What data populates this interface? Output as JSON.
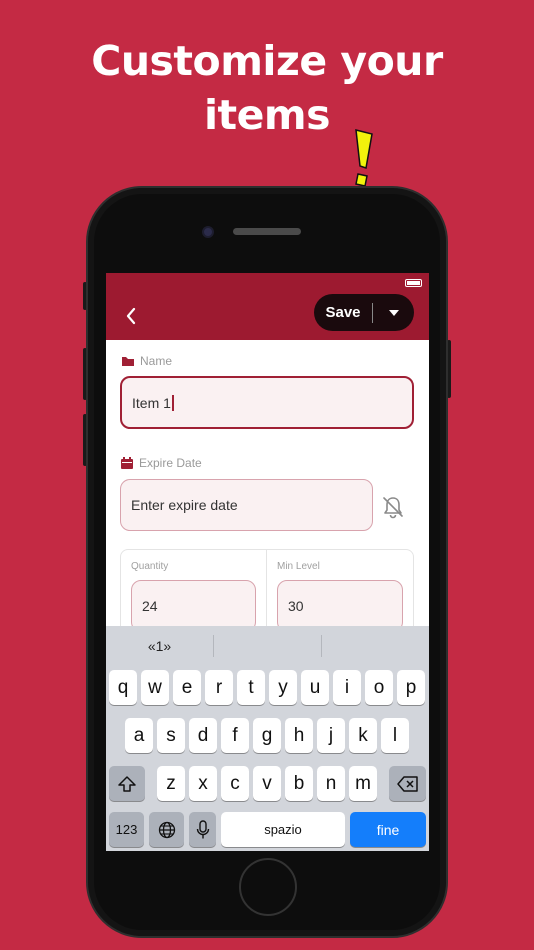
{
  "headline": {
    "line1": "Customize your",
    "line2": "items"
  },
  "appbar": {
    "save_label": "Save"
  },
  "name_field": {
    "label": "Name",
    "value": "Item 1"
  },
  "expire_field": {
    "label": "Expire Date",
    "placeholder": "Enter expire date"
  },
  "quantity_field": {
    "label": "Quantity",
    "value": "24"
  },
  "min_level_field": {
    "label": "Min Level",
    "value": "30"
  },
  "keyboard": {
    "suggestion": "«1»",
    "row1": [
      "q",
      "w",
      "e",
      "r",
      "t",
      "y",
      "u",
      "i",
      "o",
      "p"
    ],
    "row2": [
      "a",
      "s",
      "d",
      "f",
      "g",
      "h",
      "j",
      "k",
      "l"
    ],
    "row3": [
      "z",
      "x",
      "c",
      "v",
      "b",
      "n",
      "m"
    ],
    "numbers_label": "123",
    "space_label": "spazio",
    "return_label": "fine"
  },
  "colors": {
    "brand": "#c42a44",
    "appbar": "#9d1a30",
    "accent_blue": "#147efb",
    "exclaim": "#f2f20c"
  },
  "icons": [
    "back-chevron-icon",
    "chevron-down-icon",
    "folder-icon",
    "calendar-icon",
    "bell-off-icon",
    "shift-icon",
    "backspace-icon",
    "globe-icon",
    "microphone-icon"
  ]
}
